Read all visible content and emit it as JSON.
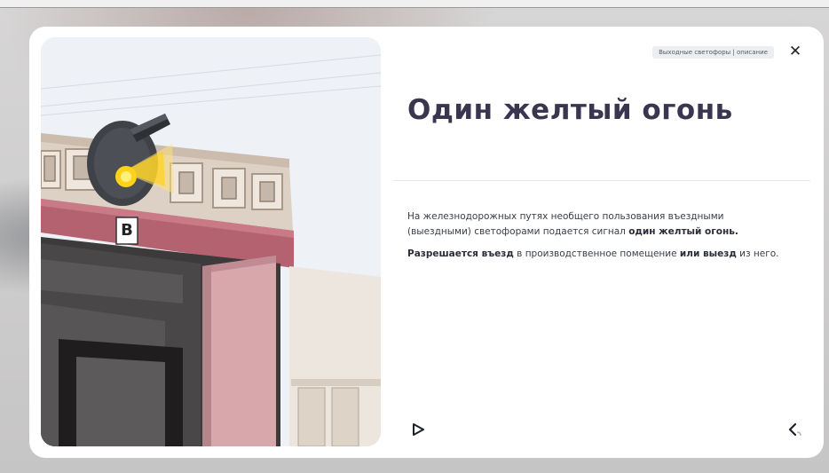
{
  "breadcrumb": "Выходные светофоры  |  описание",
  "title": "Один желтый огонь",
  "paragraph1": {
    "text": "На железнодорожных путях необщего пользования въездными (выездными) светофорами подается сигнал ",
    "bold": "один желтый огонь."
  },
  "paragraph2": {
    "bold1": "Разрешается въезд",
    "text1": " в производственное помещение ",
    "bold2": "или выезд",
    "text2": " из него."
  },
  "illustration": {
    "sign_letter": "В",
    "signal_color": "#ffd21a"
  },
  "icons": {
    "close": "close-icon",
    "play": "play-icon",
    "back": "back-arrow-icon"
  }
}
